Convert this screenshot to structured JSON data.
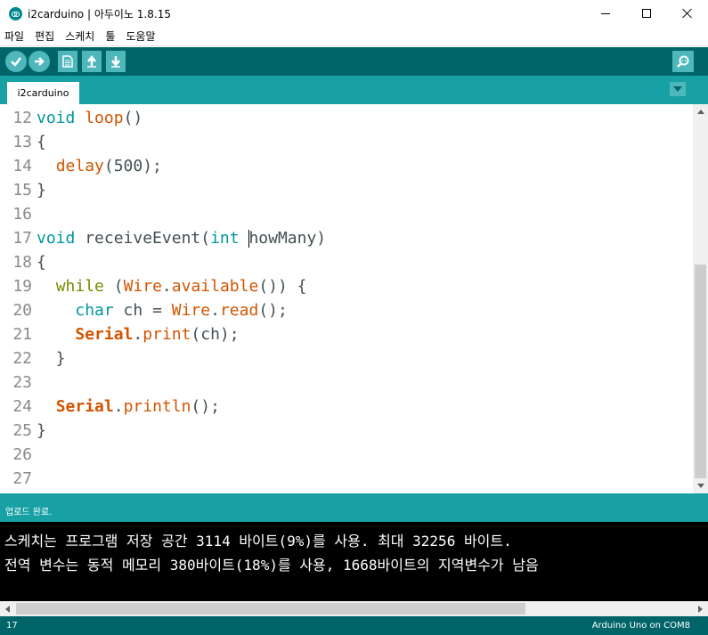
{
  "window": {
    "title": "i2carduino | 아두이노 1.8.15"
  },
  "menu": [
    "파일",
    "편집",
    "스케치",
    "툴",
    "도움말"
  ],
  "toolbar": {
    "buttons": [
      "verify-icon",
      "upload-icon",
      "new-icon",
      "open-icon",
      "save-icon",
      "serial-monitor-icon"
    ]
  },
  "tabs": [
    {
      "label": "i2carduino"
    }
  ],
  "editor": {
    "lines": [
      {
        "n": "12"
      },
      {
        "n": "13"
      },
      {
        "n": "14"
      },
      {
        "n": "15"
      },
      {
        "n": "16"
      },
      {
        "n": "17"
      },
      {
        "n": "18"
      },
      {
        "n": "19"
      },
      {
        "n": "20"
      },
      {
        "n": "21"
      },
      {
        "n": "22"
      },
      {
        "n": "23"
      },
      {
        "n": "24"
      },
      {
        "n": "25"
      },
      {
        "n": "26"
      },
      {
        "n": "27"
      }
    ],
    "code": {
      "l12": {
        "type": "void",
        "rest1": " ",
        "func": "loop",
        "rest2": "()"
      },
      "l13": "{",
      "l14": {
        "indent": "  ",
        "func": "delay",
        "rest": "(500);"
      },
      "l15": "}",
      "l17": {
        "type": "void",
        "name": " receiveEvent(",
        "ptype": "int",
        "sp": " ",
        "param": "howMany)"
      },
      "l18": "{",
      "l19": {
        "indent": "  ",
        "kw": "while",
        "sp": " (",
        "obj": "Wire",
        "dot": ".",
        "method": "available",
        "rest": "()) {"
      },
      "l20": {
        "indent": "    ",
        "type": "char",
        "mid": " ch = ",
        "obj": "Wire",
        "dot": ".",
        "method": "read",
        "rest": "();"
      },
      "l21": {
        "indent": "    ",
        "obj": "Serial",
        "dot": ".",
        "method": "print",
        "rest": "(ch);"
      },
      "l22": "  }",
      "l24": {
        "indent": "  ",
        "obj": "Serial",
        "dot": ".",
        "method": "println",
        "rest": "();"
      },
      "l25": "}"
    }
  },
  "status": {
    "message": "업로드 완료."
  },
  "console": {
    "lines": [
      "스케치는 프로그램 저장 공간 3114 바이트(9%)를 사용. 최대 32256 바이트.",
      "전역 변수는 동적 메모리 380바이트(18%)를 사용, 1668바이트의 지역변수가 남음"
    ]
  },
  "bottom": {
    "line_number": "17",
    "board": "Arduino Uno on COM8"
  },
  "colors": {
    "toolbar_bg": "#006468",
    "tabbar_bg": "#17a1a5",
    "keyword_type": "#00979c",
    "keyword_func": "#d35400",
    "keyword_struct": "#728e00"
  }
}
